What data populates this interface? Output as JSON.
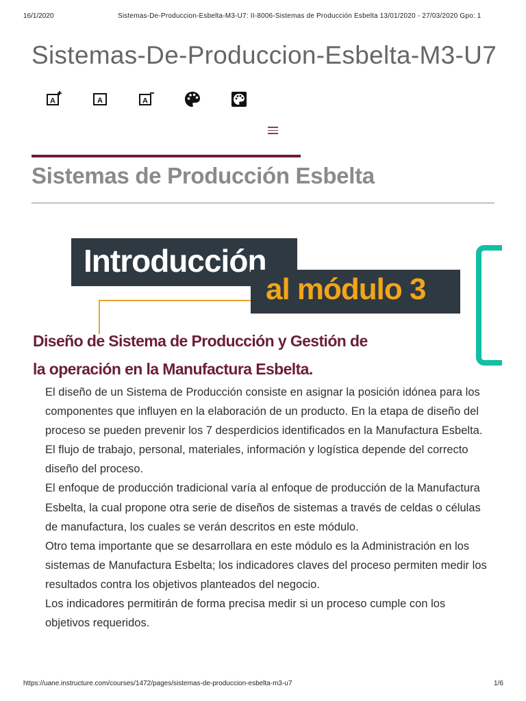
{
  "print_header": {
    "date": "16/1/2020",
    "title": "Sistemas-De-Produccion-Esbelta-M3-U7: II-8006-Sistemas de Producción Esbelta 13/01/2020 - 27/03/2020 Gpo: 1"
  },
  "course_title": "Sistemas-De-Produccion-Esbelta-M3-U7",
  "toolbar": {
    "icons": [
      {
        "name": "increase-font-icon",
        "glyph": "A"
      },
      {
        "name": "reset-font-icon",
        "glyph": "A"
      },
      {
        "name": "decrease-font-icon",
        "glyph": "A"
      },
      {
        "name": "palette-icon"
      },
      {
        "name": "palette-alt-icon"
      }
    ]
  },
  "menu": {
    "icon": "hamburger-menu-icon"
  },
  "colors": {
    "accent": "#6b1d3a",
    "title_gray": "#8a8a8a",
    "banner_dark": "#2f3942",
    "banner_yellow": "#f2a51a",
    "bracket_teal": "#10bfa4"
  },
  "page_title": "Sistemas de Producción Esbelta",
  "banner": {
    "line1": "Introducción",
    "line2": "al módulo 3"
  },
  "subheading_line1": "Diseño de Sistema de Producción y Gestión de",
  "subheading_line2": "la operación en la Manufactura Esbelta.",
  "paragraphs": [
    "El diseño de un Sistema de Producción consiste en asignar la posición idónea para los componentes que influyen en la elaboración de un producto. En la etapa de diseño del proceso se pueden prevenir los 7 desperdicios identificados en la Manufactura Esbelta.",
    "El flujo de trabajo, personal, materiales, información y logística depende del correcto diseño del proceso.",
    "El enfoque de producción tradicional varía al enfoque de producción de la Manufactura Esbelta, la cual propone otra serie de diseños de sistemas a través de celdas o células de manufactura, los cuales se verán descritos en este módulo.",
    "Otro tema importante que se desarrollara en este módulo es la Administración en los sistemas de Manufactura Esbelta; los indicadores claves del proceso permiten medir los resultados contra los objetivos planteados del negocio.",
    "Los indicadores permitirán de forma precisa medir si un proceso cumple con los objetivos requeridos."
  ],
  "print_footer": {
    "url": "https://uane.instructure.com/courses/1472/pages/sistemas-de-produccion-esbelta-m3-u7",
    "page": "1/6"
  }
}
